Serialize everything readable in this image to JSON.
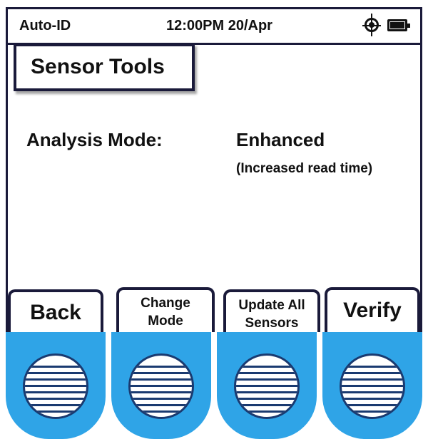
{
  "status_bar": {
    "app_name": "Auto-ID",
    "time_date": "12:00PM 20/Apr",
    "icons": [
      "gps-target-icon",
      "battery-icon"
    ]
  },
  "title": "Sensor Tools",
  "setting": {
    "label": "Analysis Mode:",
    "value": "Enhanced",
    "note": "(Increased read time)"
  },
  "softkeys": {
    "back": "Back",
    "change_line1": "Change",
    "change_line2": "Mode",
    "update_line1": "Update All",
    "update_line2": "Sensors",
    "verify": "Verify"
  },
  "colors": {
    "frame": "#1a1a3a",
    "key_blue": "#2fa4e7",
    "pad_stripe": "#1a3a70"
  }
}
